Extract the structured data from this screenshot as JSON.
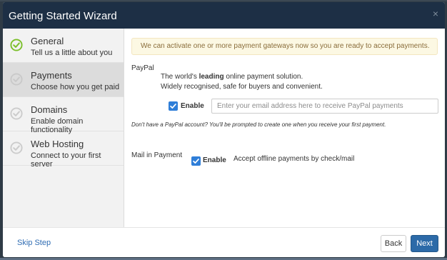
{
  "modal": {
    "title": "Getting Started Wizard",
    "close_glyph": "×"
  },
  "steps": [
    {
      "title": "General",
      "desc": "Tell us a little about you",
      "icon": "check-circle-icon",
      "state": "completed",
      "active": false
    },
    {
      "title": "Payments",
      "desc": "Choose how you get paid",
      "icon": "check-circle-icon",
      "state": "pending",
      "active": true
    },
    {
      "title": "Domains",
      "desc": "Enable domain functionality",
      "icon": "check-circle-icon",
      "state": "pending",
      "active": false
    },
    {
      "title": "Web Hosting",
      "desc": "Connect to your first server",
      "icon": "check-circle-icon",
      "state": "pending",
      "active": false
    }
  ],
  "alert": "We can activate one or more payment gateways now so you are ready to accept payments.",
  "paypal": {
    "label": "PayPal",
    "desc_prefix": "The world's ",
    "desc_bold": "leading",
    "desc_suffix": " online payment solution.",
    "desc_line2": "Widely recognised, safe for buyers and convenient.",
    "enable_label": "Enable",
    "enabled": true,
    "email_placeholder": "Enter your email address here to receive PayPal payments",
    "email_value": "",
    "note": "Don't have a PayPal account? You'll be prompted to create one when you receive your first payment."
  },
  "mail": {
    "label": "Mail in Payment",
    "enable_label": "Enable",
    "enabled": true,
    "desc": "Accept offline payments by check/mail"
  },
  "footer": {
    "skip_label": "Skip Step",
    "back_label": "Back",
    "next_label": "Next"
  },
  "colors": {
    "header_bg": "#1d2f45",
    "completed_check": "#7bbf2a",
    "pending_check": "#cccccc",
    "checkbox_blue": "#2f7ed8",
    "next_button": "#2c6aa8",
    "link": "#2f6cb3"
  }
}
